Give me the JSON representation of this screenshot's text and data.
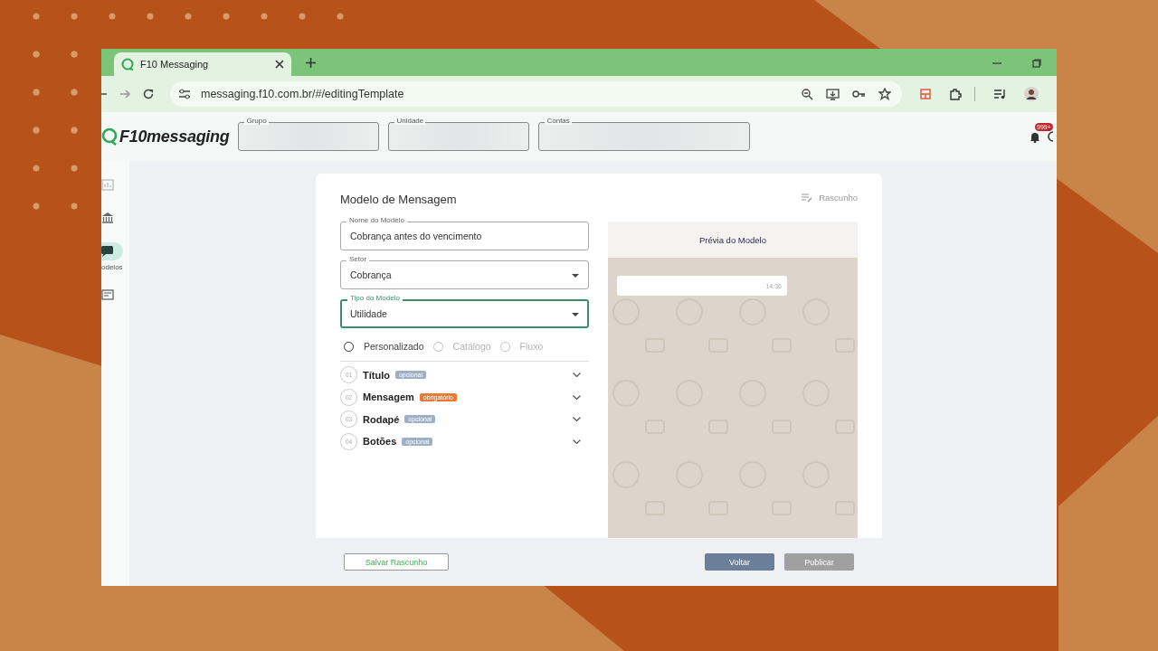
{
  "browser": {
    "tab": {
      "title": "F10 Messaging",
      "selected": true
    },
    "address": "messaging.f10.com.br/#/editingTemplate"
  },
  "header": {
    "logo": "F10messaging",
    "filters": [
      {
        "label": "Grupo"
      },
      {
        "label": "Unidade"
      },
      {
        "label": "Contas"
      }
    ],
    "notifications": "999+"
  },
  "sidebar": {
    "items": [
      {
        "selected": false
      },
      {
        "selected": false
      },
      {
        "label": "odelos",
        "selected": true
      },
      {
        "selected": false
      }
    ]
  },
  "form": {
    "title": "Modelo de Mensagem",
    "status": "Rascunho",
    "fields": [
      {
        "kind": "text",
        "label": "Nome do Modelo",
        "value": "Cobrança antes do vencimento",
        "focused": false
      },
      {
        "kind": "select",
        "label": "Setor",
        "value": "Cobrança",
        "focused": false
      },
      {
        "kind": "select",
        "label": "Tipo do Modelo",
        "value": "Utilidade",
        "focused": true
      }
    ],
    "radios": [
      {
        "label": "Personalizado",
        "selected": false,
        "disabled": false
      },
      {
        "label": "Catálogo",
        "selected": false,
        "disabled": true
      },
      {
        "label": "Fluxo",
        "selected": false,
        "disabled": true
      }
    ],
    "sections": [
      {
        "number": "01",
        "title": "Título",
        "badge": "opcional",
        "required": false
      },
      {
        "number": "02",
        "title": "Mensagem",
        "badge": "obrigatório",
        "required": true
      },
      {
        "number": "03",
        "title": "Rodapé",
        "badge": "opcional",
        "required": false
      },
      {
        "number": "04",
        "title": "Botões",
        "badge": "opcional",
        "required": false
      }
    ]
  },
  "preview": {
    "title": "Prévia do Modelo",
    "time": "14:36"
  },
  "footer": {
    "save_draft": "Salvar Rascunho",
    "back": "Voltar",
    "publish": {
      "label": "Publicar",
      "disabled": true
    }
  }
}
